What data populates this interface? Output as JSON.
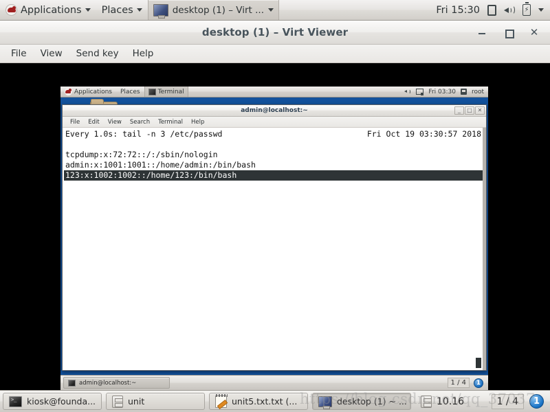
{
  "host_panel": {
    "applications_label": "Applications",
    "places_label": "Places",
    "window_button_label": "desktop (1) – Virt ...",
    "clock": "Fri 15:30",
    "icons": [
      "redhat-icon",
      "chevron-down-icon",
      "note-icon",
      "volume-icon",
      "battery-icon"
    ]
  },
  "virt_viewer": {
    "title": "desktop (1) – Virt Viewer",
    "menus": [
      "File",
      "View",
      "Send key",
      "Help"
    ],
    "window_controls": [
      "minimize",
      "maximize",
      "close"
    ]
  },
  "guest": {
    "panel": {
      "applications_label": "Applications",
      "places_label": "Places",
      "window_button_label": "Terminal",
      "clock": "Fri 03:30",
      "user": "root"
    },
    "desktop": {
      "folder_icon": "folder-icon",
      "background_color": "#12519c"
    },
    "terminal": {
      "title": "admin@localhost:~",
      "menus": [
        "File",
        "Edit",
        "View",
        "Search",
        "Terminal",
        "Help"
      ],
      "window_controls": [
        "minimize",
        "maximize",
        "close"
      ],
      "watch_header_left": "Every 1.0s: tail -n 3 /etc/passwd",
      "watch_header_right": "Fri Oct 19 03:30:57 2018",
      "lines": [
        "tcpdump:x:72:72::/:/sbin/nologin",
        "admin:x:1001:1001::/home/admin:/bin/bash"
      ],
      "selected_line": "123:x:1002:1002::/home/123:/bin/bash",
      "selection_bg": "#2e3436"
    },
    "taskbar": {
      "window_button_label": "admin@localhost:~",
      "workspace": "1 / 4",
      "badge": "1"
    }
  },
  "host_taskbar": {
    "buttons": [
      {
        "label": "kiosk@founda...",
        "icon": "terminal-icon",
        "active": false
      },
      {
        "label": "unit",
        "icon": "file-cabinet-icon",
        "active": false
      },
      {
        "label": "unit5.txt.txt (...",
        "icon": "text-editor-icon",
        "active": false
      },
      {
        "label": "desktop (1) ~ ...",
        "icon": "monitor-icon",
        "active": true
      }
    ],
    "clock_item": {
      "label": "10.16",
      "icon": "file-cabinet-icon"
    },
    "workspace": "1 / 4",
    "badge": "1"
  },
  "watermark": "https://blog.csdn.net/qq_37037"
}
